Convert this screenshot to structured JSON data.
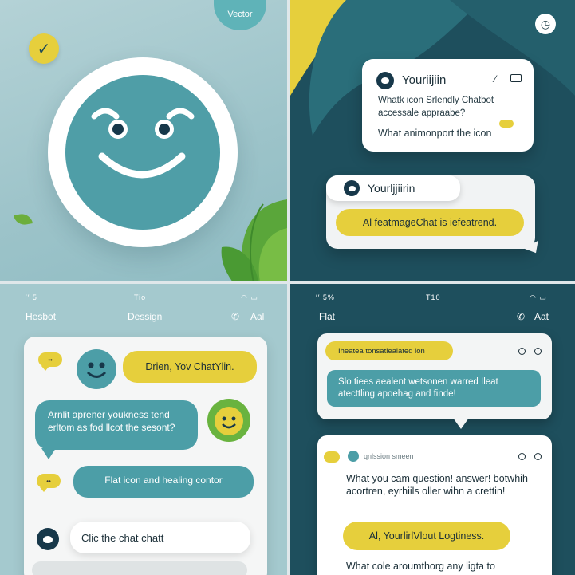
{
  "colors": {
    "teal": "#4c9ea7",
    "dark_teal": "#1e4f5d",
    "yellow": "#e6cf3c",
    "navy": "#17384a",
    "white": "#ffffff"
  },
  "q1": {
    "tag": "Vector",
    "check_icon": "check-icon",
    "mascot_icon": "smiling-chat-bubble-icon"
  },
  "q2": {
    "timer_icon": "clock-icon",
    "card1": {
      "name": "Youriijiin",
      "line1": "Whatk icon Srlendly Chatbot",
      "line2": "accessale appraabe?",
      "line3": "What animonport the icon"
    },
    "card2": {
      "name": "Yourljjiirin",
      "message": "Al featmageChat is iefeatrend."
    }
  },
  "q3": {
    "status_left": "′′ 5",
    "status_center": "Tio",
    "nav_left": "Hesbot",
    "nav_center": "Dessign",
    "nav_right": "Aal",
    "chip1": "••",
    "chip2": "••",
    "msg_yellow": "Drien, Yov ChatYlin.",
    "msg_teal_1": "Arnlit aprener youkness tend erltom as fod llcot the sesont?",
    "msg_teal_2": "Flat icon and healing contor",
    "msg_input": "Clic the chat chatt"
  },
  "q4": {
    "status_left": "′′ 5%",
    "status_center": "T10",
    "nav_left": "Flat",
    "nav_right": "Aat",
    "tag": "Iheatea tonsatlealated lon",
    "teal_msg": "Slo tiees aealent wetsonen warred Ileat atecttling apoehag and finde!",
    "header": "qnlssion smeen",
    "body": "What you cam question! answer! botwhih acortren, eyrhiils oller wihn a crettin!",
    "yellow_msg": "Al, YourlirlVlout Logtiness.",
    "footer": "What cole aroumthorg any ligta to"
  }
}
